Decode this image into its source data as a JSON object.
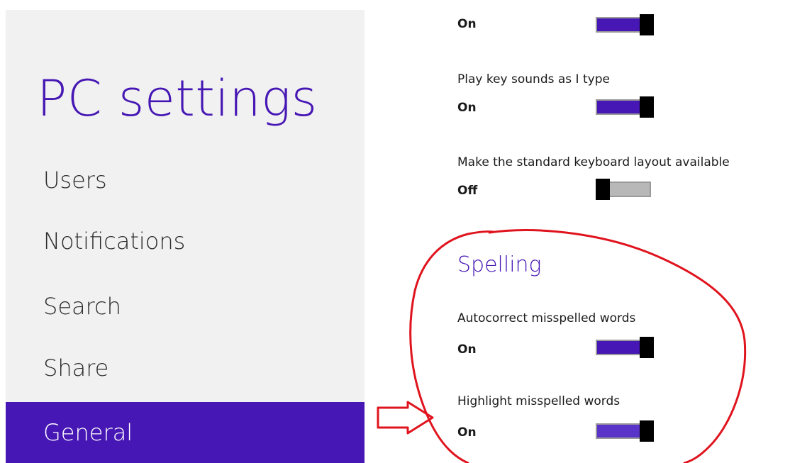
{
  "app": {
    "title": "PC settings"
  },
  "sidebar": {
    "items": [
      {
        "label": "Users",
        "selected": false
      },
      {
        "label": "Notifications",
        "selected": false
      },
      {
        "label": "Search",
        "selected": false
      },
      {
        "label": "Share",
        "selected": false
      },
      {
        "label": "General",
        "selected": true
      }
    ]
  },
  "settings": {
    "top_toggle": {
      "state": "On",
      "on": true
    },
    "key_sounds": {
      "label": "Play key sounds as I type",
      "state": "On",
      "on": true
    },
    "standard_keyboard": {
      "label": "Make the standard keyboard layout available",
      "state": "Off",
      "on": false
    },
    "spelling": {
      "heading": "Spelling",
      "autocorrect": {
        "label": "Autocorrect misspelled words",
        "state": "On",
        "on": true
      },
      "highlight": {
        "label": "Highlight misspelled words",
        "state": "On",
        "on": true
      }
    }
  },
  "colors": {
    "accent": "#4617b4",
    "annotation": "#e0141e",
    "sidebar_bg": "#f1f1f1"
  }
}
